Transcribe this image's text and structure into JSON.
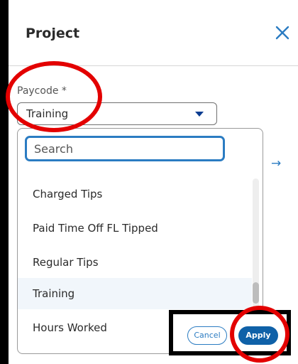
{
  "header": {
    "title": "Project"
  },
  "field": {
    "label": "Paycode *",
    "selected": "Training"
  },
  "dropdown": {
    "search_placeholder": "Search",
    "options": [
      {
        "label": "Charged Tips"
      },
      {
        "label": "Paid Time Off FL Tipped"
      },
      {
        "label": "Regular Tips"
      },
      {
        "label": "Training"
      },
      {
        "label": "Hours Worked"
      }
    ]
  },
  "actions": {
    "cancel": "Cancel",
    "apply": "Apply"
  },
  "colors": {
    "accent": "#2b7cc2",
    "primary_button": "#0f61a8",
    "annotation": "#e30000"
  },
  "icons": {
    "close": "close-icon",
    "caret": "chevron-down-icon",
    "arrow": "arrow-right-icon"
  }
}
